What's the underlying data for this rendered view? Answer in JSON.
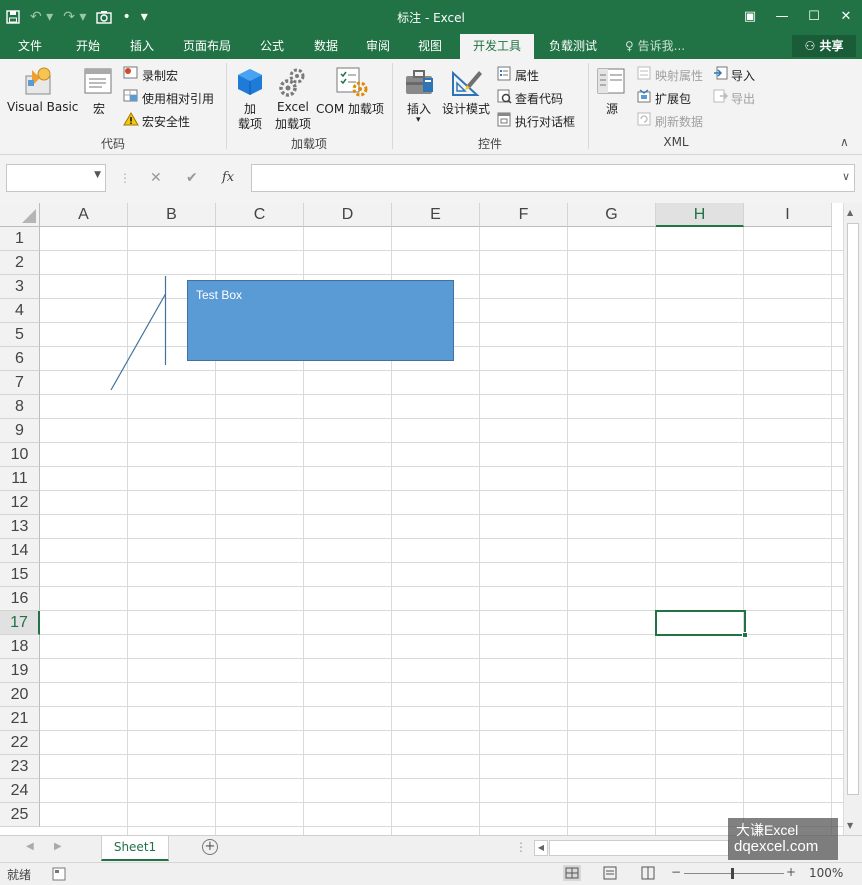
{
  "title": "标注 - Excel",
  "window_buttons": {
    "ribbon_display": "▣",
    "minimize": "—",
    "maximize": "☐",
    "close": "✕"
  },
  "tabs": [
    "文件",
    "开始",
    "插入",
    "页面布局",
    "公式",
    "数据",
    "审阅",
    "视图",
    "开发工具",
    "负载测试"
  ],
  "active_tab": "开发工具",
  "tell_me": "告诉我...",
  "share": "共享",
  "ribbon": {
    "code": {
      "visual_basic": "Visual Basic",
      "macros": "宏",
      "record_macro": "录制宏",
      "relative_ref": "使用相对引用",
      "macro_security": "宏安全性",
      "group": "代码"
    },
    "addins": {
      "addins_line1": "加",
      "addins_line2": "载项",
      "excel_addins_line1": "Excel",
      "excel_addins_line2": "加载项",
      "com_addins": "COM 加载项",
      "group": "加载项"
    },
    "controls": {
      "insert": "插入",
      "design_mode": "设计模式",
      "properties": "属性",
      "view_code": "查看代码",
      "run_dialog": "执行对话框",
      "group": "控件"
    },
    "xml": {
      "source": "源",
      "map_properties": "映射属性",
      "expansion_packs": "扩展包",
      "refresh_data": "刷新数据",
      "import": "导入",
      "export": "导出",
      "group": "XML"
    }
  },
  "formula_bar": {
    "name_box": "",
    "cancel": "✕",
    "enter": "✔",
    "fx": "fx",
    "formula": ""
  },
  "columns": [
    "A",
    "B",
    "C",
    "D",
    "E",
    "F",
    "G",
    "H",
    "I"
  ],
  "rows": [
    "1",
    "2",
    "3",
    "4",
    "5",
    "6",
    "7",
    "8",
    "9",
    "10",
    "11",
    "12",
    "13",
    "14",
    "15",
    "16",
    "17",
    "18",
    "19",
    "20",
    "21",
    "22",
    "23",
    "24",
    "25"
  ],
  "active_column": "H",
  "active_row": "17",
  "textbox": {
    "text": "Test Box"
  },
  "sheet_tab": "Sheet1",
  "status": {
    "ready": "就绪",
    "zoom": "100%",
    "zoom_minus": "−",
    "zoom_plus": "+"
  },
  "watermark": {
    "line1": "大谦Excel",
    "line2": "dqexcel.com"
  },
  "colors": {
    "accent": "#217346",
    "textbox_fill": "#5b9bd5"
  }
}
